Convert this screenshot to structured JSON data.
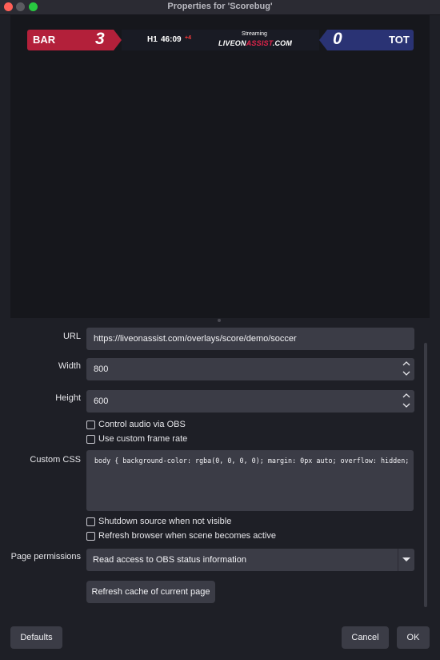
{
  "window": {
    "title": "Properties for 'Scorebug'"
  },
  "scorebug": {
    "home_team": "BAR",
    "home_score": "3",
    "period": "H1",
    "clock": "46:09",
    "added_time": "+4",
    "streaming_label": "Streaming",
    "logo_part1": "LIVEON",
    "logo_part2": "ASSIST",
    "logo_part3": ".COM",
    "away_score": "0",
    "away_team": "TOT",
    "home_color": "#b3203a",
    "away_color": "#2a3374"
  },
  "form": {
    "url_label": "URL",
    "url_value": "https://liveonassist.com/overlays/score/demo/soccer",
    "width_label": "Width",
    "width_value": "800",
    "height_label": "Height",
    "height_value": "600",
    "control_audio_label": "Control audio via OBS",
    "custom_frame_rate_label": "Use custom frame rate",
    "custom_css_label": "Custom CSS",
    "custom_css_value": "body { background-color: rgba(0, 0, 0, 0); margin: 0px auto; overflow: hidden; }",
    "shutdown_label": "Shutdown source when not visible",
    "refresh_label": "Refresh browser when scene becomes active",
    "permissions_label": "Page permissions",
    "permissions_value": "Read access to OBS status information",
    "refresh_cache_label": "Refresh cache of current page"
  },
  "footer": {
    "defaults_label": "Defaults",
    "cancel_label": "Cancel",
    "ok_label": "OK"
  },
  "icons": {
    "spin_up": "chevron-up-icon",
    "spin_down": "chevron-down-icon",
    "select_caret": "caret-down-icon"
  }
}
